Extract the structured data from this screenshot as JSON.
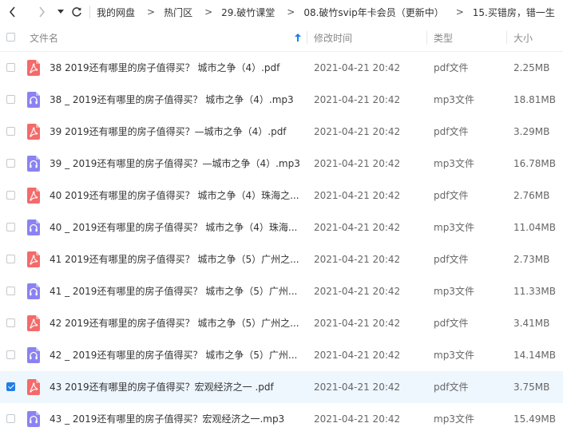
{
  "breadcrumb": [
    "我的网盘",
    "热门区",
    "29.破竹课堂",
    "08.破竹svip年卡会员（更新中）",
    "15.买错房，错一生"
  ],
  "header": {
    "name": "文件名",
    "time": "修改时间",
    "type": "类型",
    "size": "大小"
  },
  "colors": {
    "pdf": "#f46a6a",
    "mp3": "#8b82f2",
    "accent": "#1f7de8"
  },
  "files": [
    {
      "name": "38  2019还有哪里的房子值得买？ 城市之争（4）.pdf",
      "time": "2021-04-21 20:42",
      "type": "pdf文件",
      "size": "2.25MB",
      "icon": "pdf-file-icon",
      "selected": false
    },
    {
      "name": "38 _ 2019还有哪里的房子值得买？ 城市之争（4）.mp3",
      "time": "2021-04-21 20:42",
      "type": "mp3文件",
      "size": "18.81MB",
      "icon": "audio-file-icon",
      "selected": false
    },
    {
      "name": "39  2019还有哪里的房子值得买？—城市之争（4）.pdf",
      "time": "2021-04-21 20:42",
      "type": "pdf文件",
      "size": "3.29MB",
      "icon": "pdf-file-icon",
      "selected": false
    },
    {
      "name": "39 _ 2019还有哪里的房子值得买？—城市之争（4）.mp3",
      "time": "2021-04-21 20:42",
      "type": "mp3文件",
      "size": "16.78MB",
      "icon": "audio-file-icon",
      "selected": false
    },
    {
      "name": "40  2019还有哪里的房子值得买？ 城市之争（4）珠海之...",
      "time": "2021-04-21 20:42",
      "type": "pdf文件",
      "size": "2.76MB",
      "icon": "pdf-file-icon",
      "selected": false
    },
    {
      "name": "40 _ 2019还有哪里的房子值得买？ 城市之争（4）珠海...",
      "time": "2021-04-21 20:42",
      "type": "mp3文件",
      "size": "11.04MB",
      "icon": "audio-file-icon",
      "selected": false
    },
    {
      "name": "41  2019还有哪里的房子值得买？ 城市之争（5）广州之...",
      "time": "2021-04-21 20:42",
      "type": "pdf文件",
      "size": "2.73MB",
      "icon": "pdf-file-icon",
      "selected": false
    },
    {
      "name": "41 _ 2019还有哪里的房子值得买？ 城市之争（5）广州...",
      "time": "2021-04-21 20:42",
      "type": "mp3文件",
      "size": "11.33MB",
      "icon": "audio-file-icon",
      "selected": false
    },
    {
      "name": "42  2019还有哪里的房子值得买？ 城市之争（5）广州之...",
      "time": "2021-04-21 20:42",
      "type": "pdf文件",
      "size": "3.41MB",
      "icon": "pdf-file-icon",
      "selected": false
    },
    {
      "name": "42 _ 2019还有哪里的房子值得买？ 城市之争（5）广州...",
      "time": "2021-04-21 20:42",
      "type": "mp3文件",
      "size": "14.14MB",
      "icon": "audio-file-icon",
      "selected": false
    },
    {
      "name": "43  2019还有哪里的房子值得买？宏观经济之一 .pdf",
      "time": "2021-04-21 20:42",
      "type": "pdf文件",
      "size": "3.75MB",
      "icon": "pdf-file-icon",
      "selected": true
    },
    {
      "name": "43 _ 2019还有哪里的房子值得买？宏观经济之一.mp3",
      "time": "2021-04-21 20:42",
      "type": "mp3文件",
      "size": "15.49MB",
      "icon": "audio-file-icon",
      "selected": false
    }
  ]
}
